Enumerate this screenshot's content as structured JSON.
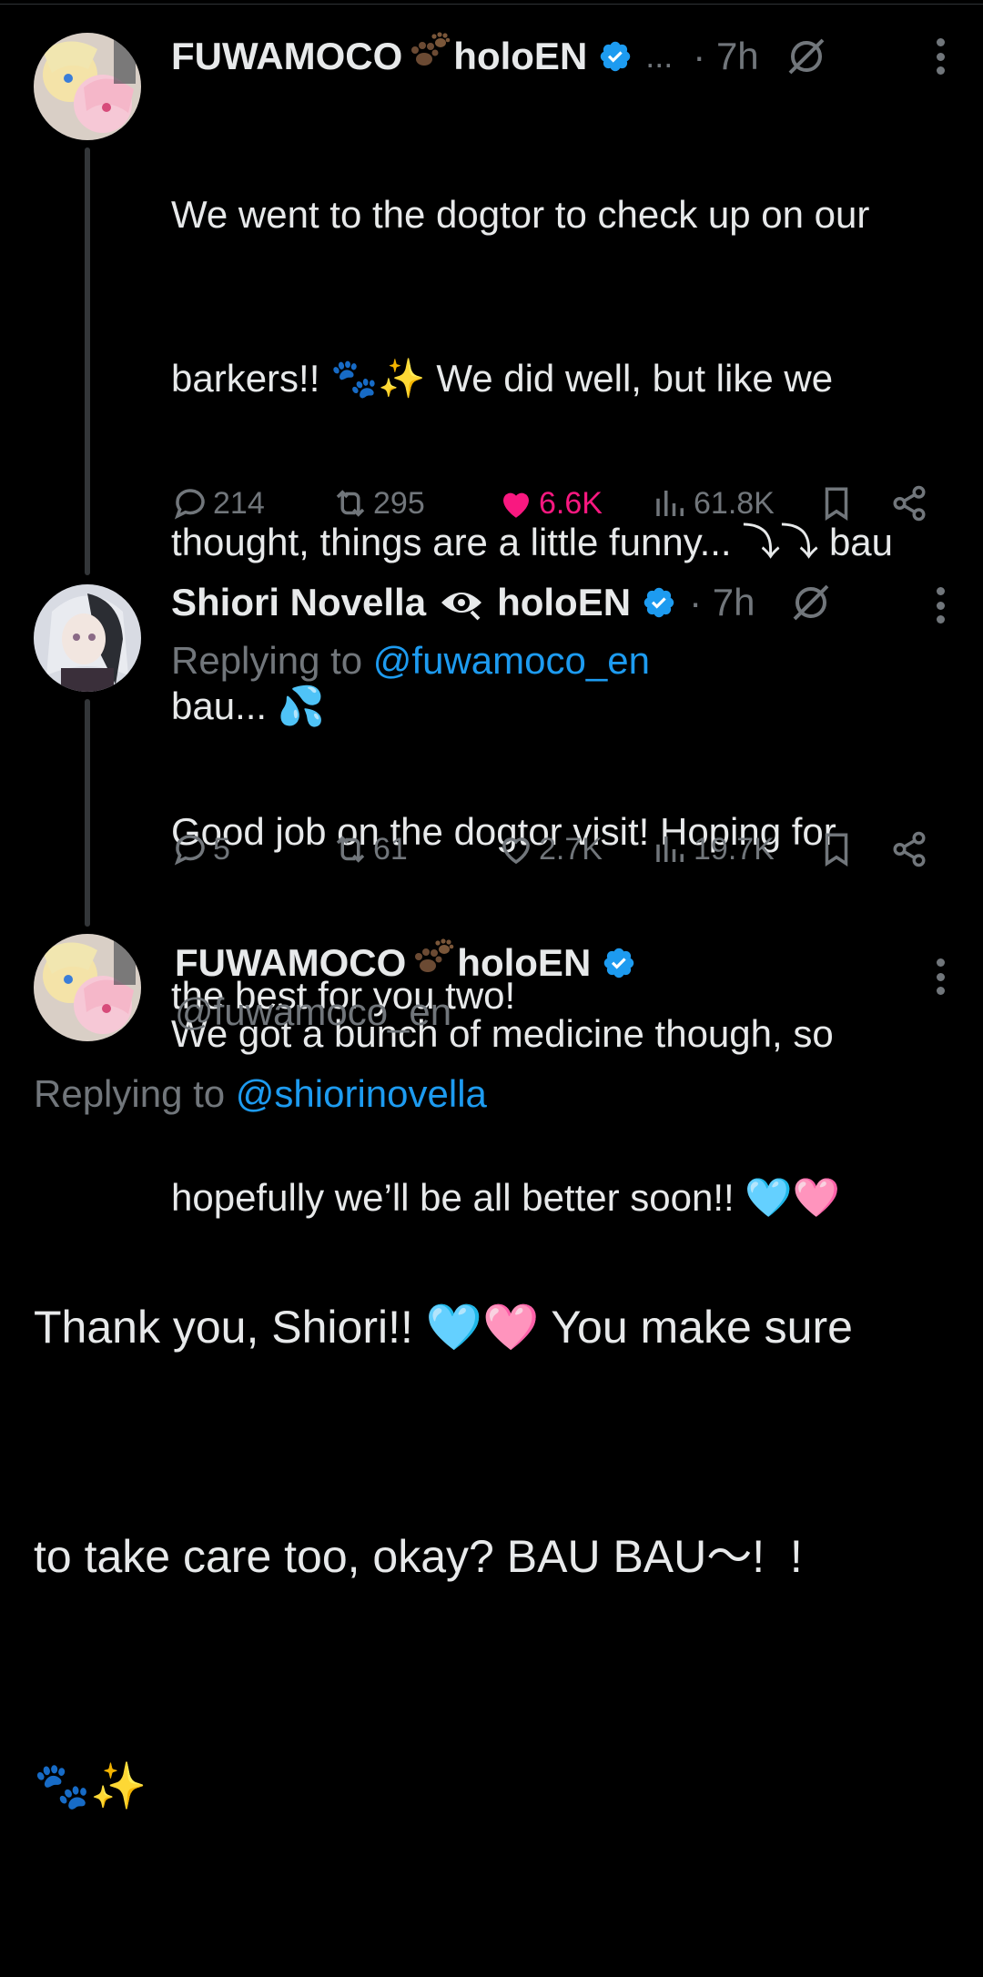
{
  "tweets": [
    {
      "name": "FUWAMOCO",
      "affiliation": "holoEN",
      "ellipsis": "...",
      "time": "· 7h",
      "text_lines": [
        "We went to the dogtor to check up on our",
        "barkers!! 🐾✨ We did well, but like we",
        "thought, things are a little funny... ⤵⤵ bau",
        "bau... 💦",
        "",
        "We got a bunch of medicine though, so",
        "hopefully we’ll be all better soon!! 🩵🩷"
      ],
      "replies": "214",
      "reposts": "295",
      "likes": "6.6K",
      "views": "61.8K"
    },
    {
      "name": "Shiori Novella",
      "affiliation": "holoEN",
      "time": "· 7h",
      "reply_prefix": "Replying to",
      "reply_handle": "@fuwamoco_en",
      "text_lines": [
        "Good job on the dogtor visit! Hoping for",
        "the best for you two!"
      ],
      "replies": "5",
      "reposts": "61",
      "likes": "2.7K",
      "views": "19.7K"
    },
    {
      "name": "FUWAMOCO",
      "affiliation": "holoEN",
      "handle": "@fuwamoco_en",
      "reply_prefix": "Replying to",
      "reply_handle": "@shiorinovella",
      "text_lines": [
        "Thank you, Shiori!! 🩵🩷 You make sure",
        "to take care too, okay? BAU BAU〜!  !",
        "🐾✨"
      ]
    }
  ],
  "colors": {
    "background": "#000000",
    "text": "#e7e9ea",
    "muted": "#71767b",
    "link": "#1d9bf0",
    "like": "#f91880",
    "verified": "#1d9bf0"
  }
}
